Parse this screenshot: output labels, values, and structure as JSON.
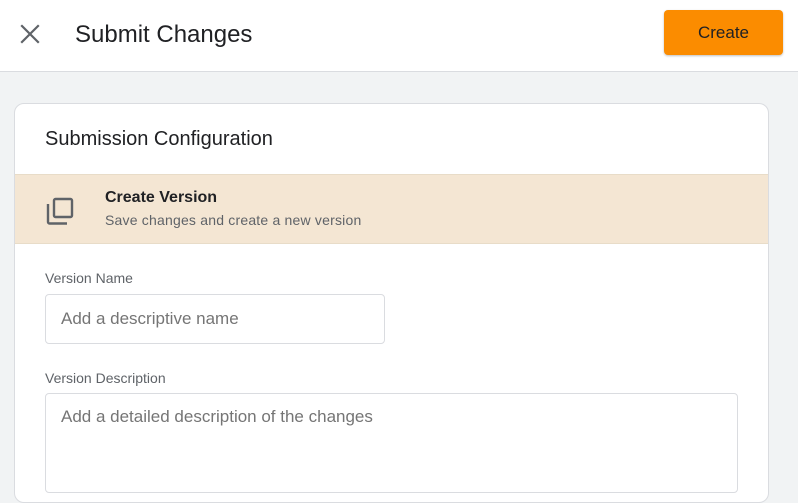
{
  "header": {
    "title": "Submit Changes",
    "create_label": "Create",
    "close_icon": "close-icon"
  },
  "card": {
    "title": "Submission Configuration",
    "option": {
      "icon": "copy-icon",
      "title": "Create Version",
      "subtitle": "Save changes and create a new version"
    },
    "fields": {
      "version_name": {
        "label": "Version Name",
        "value": "",
        "placeholder": "Add a descriptive name"
      },
      "version_description": {
        "label": "Version Description",
        "value": "",
        "placeholder": "Add a detailed description of the changes"
      }
    }
  },
  "colors": {
    "accent": "#fb8c00",
    "selected_option_bg": "#f4e6d3",
    "page_bg": "#f1f3f4"
  }
}
